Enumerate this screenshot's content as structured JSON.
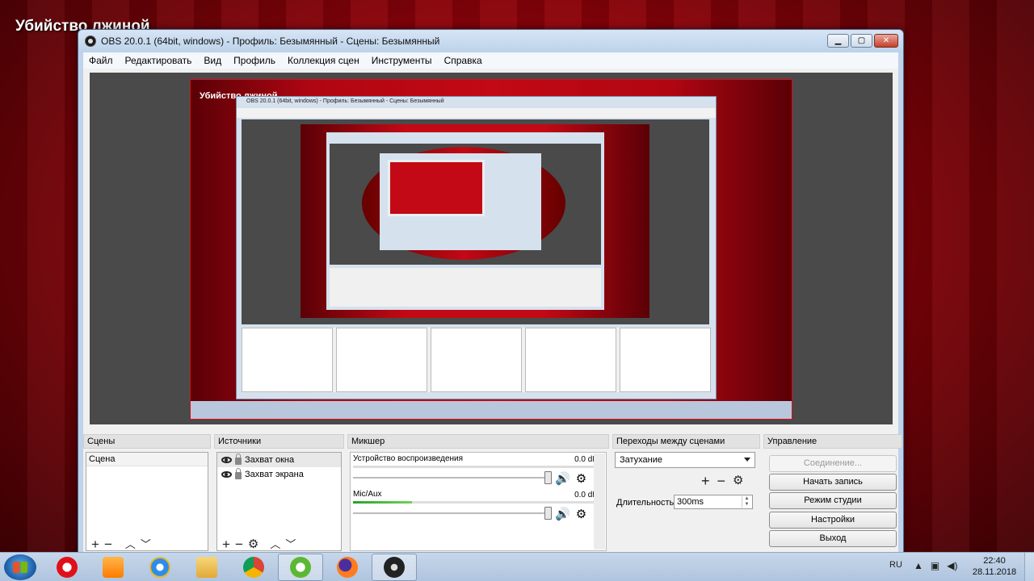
{
  "desktop": {
    "title": "Убийство лжиной"
  },
  "window": {
    "title": "OBS 20.0.1 (64bit, windows) - Профиль: Безымянный - Сцены: Безымянный",
    "buttons": {
      "minimize": "▁",
      "maximize": "▢",
      "close": "✕"
    }
  },
  "menu": [
    "Файл",
    "Редактировать",
    "Вид",
    "Профиль",
    "Коллекция сцен",
    "Инструменты",
    "Справка"
  ],
  "preview": {
    "capture_title": "Убийство лжиной"
  },
  "scenes": {
    "header": "Сцены",
    "items": [
      "Сцена"
    ]
  },
  "sources": {
    "header": "Источники",
    "items": [
      "Захват окна",
      "Захват экрана"
    ]
  },
  "mixer": {
    "header": "Микшер",
    "tracks": [
      {
        "name": "Устройство воспроизведения",
        "db": "0.0 dB",
        "level": 0.0
      },
      {
        "name": "Mic/Aux",
        "db": "0.0 dB",
        "level": 0.24
      }
    ]
  },
  "transitions": {
    "header": "Переходы между сценами",
    "selected": "Затухание",
    "duration_label": "Длительность",
    "duration_value": "300ms"
  },
  "controls": {
    "header": "Управление",
    "connect": "Соединение...",
    "start_recording": "Начать запись",
    "studio_mode": "Режим студии",
    "settings": "Настройки",
    "exit": "Выход"
  },
  "toolbar_glyphs": {
    "add": "+",
    "remove": "−",
    "up": "︿",
    "down": "﹀",
    "gear": "⚙"
  },
  "taskbar": {
    "apps": [
      "opera-icon",
      "media-player-icon",
      "internet-explorer-icon",
      "file-explorer-icon",
      "chrome-icon",
      "utorrent-icon",
      "firefox-icon",
      "obs-icon"
    ],
    "lang": "RU",
    "time": "22:40",
    "date": "28.11.2018"
  },
  "colors": {
    "accent_red": "#c20915",
    "meter_green": "#2aa12a"
  }
}
